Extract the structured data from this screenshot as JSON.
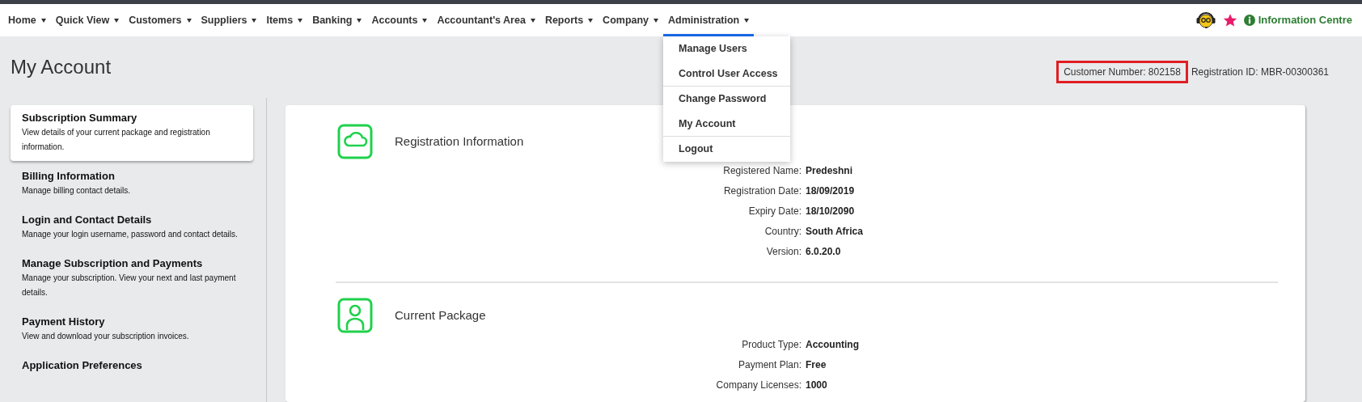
{
  "nav": {
    "items": [
      {
        "label": "Home",
        "selected": false
      },
      {
        "label": "Quick View",
        "selected": false
      },
      {
        "label": "Customers",
        "selected": false
      },
      {
        "label": "Suppliers",
        "selected": false
      },
      {
        "label": "Items",
        "selected": false
      },
      {
        "label": "Banking",
        "selected": false
      },
      {
        "label": "Accounts",
        "selected": false
      },
      {
        "label": "Accountant's Area",
        "selected": false
      },
      {
        "label": "Reports",
        "selected": false
      },
      {
        "label": "Company",
        "selected": false
      },
      {
        "label": "Administration",
        "selected": true
      }
    ],
    "info_link": "Information Centre"
  },
  "menu": {
    "items": [
      {
        "label": "Manage Users",
        "divider_after": false
      },
      {
        "label": "Control User Access",
        "divider_after": true
      },
      {
        "label": "Change Password",
        "divider_after": false
      },
      {
        "label": "My Account",
        "divider_after": true
      },
      {
        "label": "Logout",
        "divider_after": false
      }
    ]
  },
  "header": {
    "title": "My Account",
    "customer_number": {
      "text": "Customer Number: 802158",
      "highlighted": true
    },
    "registration_id": "Registration ID: MBR-00300361"
  },
  "sidebar": {
    "items": [
      {
        "title": "Subscription Summary",
        "description": "View details of your current package and registration information.",
        "selected": true
      },
      {
        "title": "Billing Information",
        "description": "Manage billing contact details.",
        "selected": false
      },
      {
        "title": "Login and Contact Details",
        "description": "Manage your login username, password and contact details.",
        "selected": false
      },
      {
        "title": "Manage Subscription and Payments",
        "description": "Manage your subscription. View your next and last payment details.",
        "selected": false
      },
      {
        "title": "Payment History",
        "description": "View and download your subscription invoices.",
        "selected": false
      },
      {
        "title": "Application Preferences",
        "selected": false
      }
    ]
  },
  "sections": [
    {
      "title": "Registration Information",
      "kind": "cloud",
      "fields": [
        {
          "label": "Registered Name:",
          "value": "Predeshni"
        },
        {
          "label": "Registration Date:",
          "value": "18/09/2019"
        },
        {
          "label": "Expiry Date:",
          "value": "18/10/2090"
        },
        {
          "label": "Country:",
          "value": "South Africa"
        },
        {
          "label": "Version:",
          "value": "6.0.20.0"
        }
      ]
    },
    {
      "title": "Current Package",
      "kind": "person",
      "fields": [
        {
          "label": "Product Type:",
          "value": "Accounting"
        },
        {
          "label": "Payment Plan:",
          "value": "Free"
        },
        {
          "label": "Company Licenses:",
          "value": "1000"
        }
      ]
    }
  ]
}
